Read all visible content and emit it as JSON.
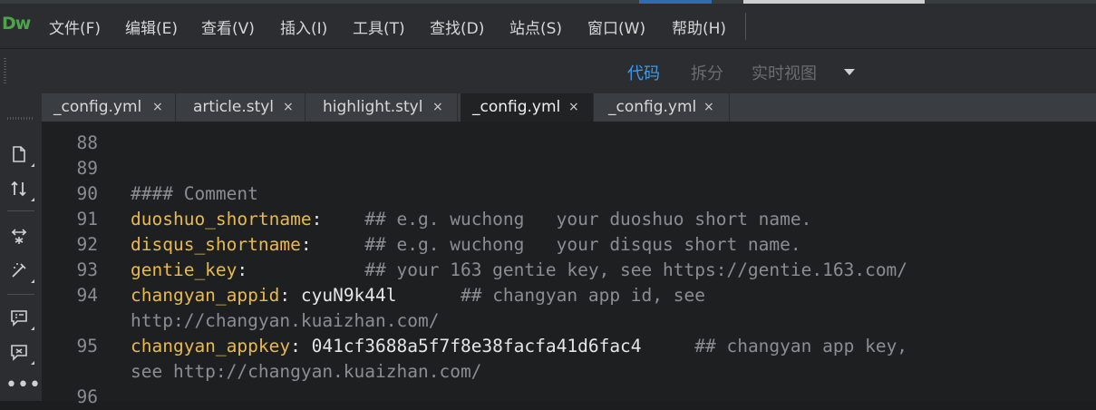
{
  "app": {
    "logo": "Dw"
  },
  "menu": [
    "文件(F)",
    "编辑(E)",
    "查看(V)",
    "插入(I)",
    "工具(T)",
    "查找(D)",
    "站点(S)",
    "窗口(W)",
    "帮助(H)"
  ],
  "views": {
    "code": "代码",
    "split": "拆分",
    "live": "实时视图",
    "active": "代码"
  },
  "tabs": [
    {
      "label": "_config.yml",
      "active": false
    },
    {
      "label": "article.styl",
      "active": false
    },
    {
      "label": "highlight.styl",
      "active": false
    },
    {
      "label": "_config.yml",
      "active": true
    },
    {
      "label": "_config.yml",
      "active": false
    }
  ],
  "tab_close_glyph": "×",
  "lines": [
    {
      "num": "88",
      "key": "",
      "sep": "",
      "value": "",
      "comment": ""
    },
    {
      "num": "89",
      "key": "",
      "sep": "",
      "value": "",
      "comment": ""
    },
    {
      "num": "90",
      "key": "",
      "sep": "",
      "value": "",
      "comment": "#### Comment"
    },
    {
      "num": "91",
      "key": "duoshuo_shortname",
      "sep": ":    ",
      "value": "",
      "comment": "## e.g. wuchong   your duoshuo short name."
    },
    {
      "num": "92",
      "key": "disqus_shortname",
      "sep": ":     ",
      "value": "",
      "comment": "## e.g. wuchong   your disqus short name."
    },
    {
      "num": "93",
      "key": "gentie_key",
      "sep": ":           ",
      "value": "",
      "comment": "## your 163 gentie key, see https://gentie.163.com/"
    },
    {
      "num": "94",
      "key": "changyan_appid",
      "sep": ": ",
      "value": "cyuN9k44l",
      "comment": "      ## changyan app id, see"
    },
    {
      "num": "",
      "key": "",
      "sep": "",
      "value": "",
      "comment": "http://changyan.kuaizhan.com/"
    },
    {
      "num": "95",
      "key": "changyan_appkey",
      "sep": ": ",
      "value": "041cf3688a5f7f8e38facfa41d6fac4",
      "comment": "     ## changyan app key,"
    },
    {
      "num": "",
      "key": "",
      "sep": "",
      "value": "",
      "comment": "see http://changyan.kuaizhan.com/"
    },
    {
      "num": "96",
      "key": "",
      "sep": "",
      "value": "",
      "comment": ""
    }
  ],
  "colors": {
    "key": "#e9b94e",
    "comment": "#8b8e91",
    "value": "#e6e6e6",
    "accent": "#3f9be6",
    "logo": "#4ea44a"
  },
  "left_toolbar_icons": [
    "file-icon",
    "sort-icon",
    "expand-icon",
    "wand-icon",
    "comment-icon",
    "comment-remove-icon",
    "more-icon"
  ]
}
